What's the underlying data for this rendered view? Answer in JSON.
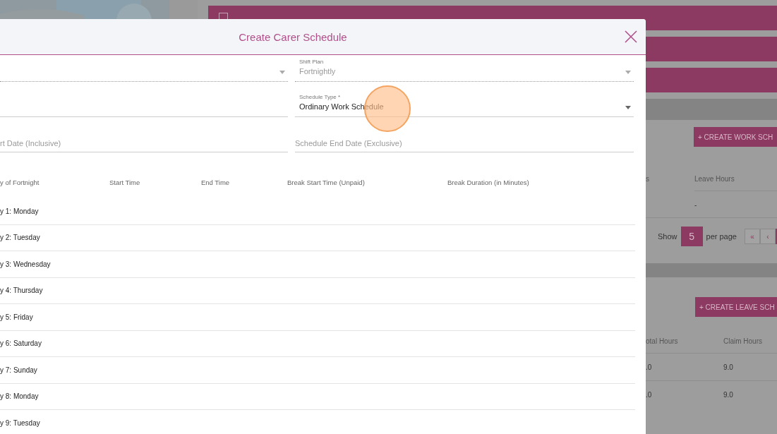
{
  "background_page": {
    "work_schedule": {
      "create_button": "+ CREATE WORK SCH",
      "columns": [
        {
          "label": "s"
        },
        {
          "label": "Leave Hours",
          "cells": [
            "-"
          ]
        }
      ],
      "pagination": {
        "show_label": "Show",
        "page_size": "5",
        "per_page_label": "per page",
        "page_buttons": [
          "«",
          "‹"
        ]
      }
    },
    "leave_schedule": {
      "create_button": "+ CREATE LEAVE SCH",
      "columns": [
        {
          "label": "otal Hours",
          "cells": [
            ".0",
            ".0"
          ]
        },
        {
          "label": "Claim Hours",
          "cells": [
            "9.0",
            "9.0"
          ]
        }
      ]
    }
  },
  "dialog": {
    "title": "Create Carer Schedule",
    "fields": [
      {
        "kind": "select",
        "disabled": true
      },
      {
        "kind": "select",
        "label": "Shift Plan",
        "value": "Fortnightly",
        "disabled": true
      },
      {
        "kind": "text",
        "disabled": false
      },
      {
        "kind": "select",
        "label": "Schedule Type *",
        "value": "Ordinary Work Schedule",
        "disabled": false
      },
      {
        "kind": "date",
        "placeholder": "rt Date (Inclusive)",
        "disabled": false
      },
      {
        "kind": "date",
        "placeholder": "Schedule End Date (Exclusive)",
        "disabled": false
      }
    ],
    "table": {
      "columns": [
        "y of Fortnight",
        "Start Time",
        "End Time",
        "Break Start Time (Unpaid)",
        "Break Duration (in Minutes)"
      ],
      "rows": [
        "y 1: Monday",
        "y 2: Tuesday",
        "y 3: Wednesday",
        "y 4: Thursday",
        "y 5: Friday",
        "y 6: Saturday",
        "y 7: Sunday",
        "y 8: Monday",
        "y 9: Tuesday"
      ]
    }
  }
}
